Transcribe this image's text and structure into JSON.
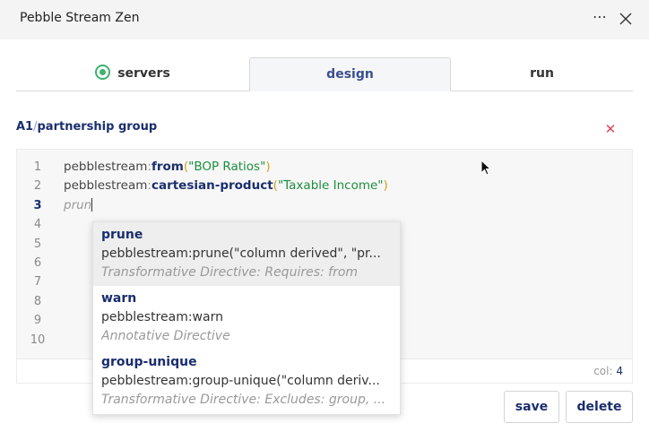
{
  "window": {
    "title": "Pebble Stream Zen",
    "more_icon": "⋯",
    "close_icon": "close-icon"
  },
  "tabs": [
    {
      "label": "servers",
      "status": "connected",
      "status_color": "#3cb371"
    },
    {
      "label": "design",
      "active": true
    },
    {
      "label": "run"
    }
  ],
  "breadcrumb": {
    "prefix": "A1",
    "separator": "/",
    "name": "partnership group",
    "remove_icon": "✕"
  },
  "editor": {
    "line_numbers": [
      "1",
      "2",
      "3",
      "4",
      "5",
      "6",
      "7",
      "8",
      "9",
      "10"
    ],
    "active_line": "3",
    "lines": [
      {
        "ns": "pebblestream",
        "colon": ":",
        "fn": "from",
        "open": "(",
        "arg": "\"BOP Ratios\"",
        "close": ")"
      },
      {
        "ns": "pebblestream",
        "colon": ":",
        "fn": "cartesian-product",
        "open": "(",
        "arg": "\"Taxable Income\"",
        "close": ")"
      },
      {
        "typing": "prun"
      }
    ],
    "status": {
      "col_label": "col:",
      "col_value": "4"
    }
  },
  "autocomplete": [
    {
      "name": "prune",
      "signature": "pebblestream:prune(\"column derived\", \"pr...",
      "description": "Transformative Directive: Requires: from",
      "selected": true
    },
    {
      "name": "warn",
      "signature": "pebblestream:warn",
      "description": "Annotative Directive"
    },
    {
      "name": "group-unique",
      "signature": "pebblestream:group-unique(\"column deriv...",
      "description": "Transformative Directive: Excludes: group, ..."
    }
  ],
  "actions": {
    "save_label": "save",
    "delete_label": "delete"
  },
  "colors": {
    "accent": "#1a2e6e",
    "string": "#1e8e3e",
    "paren": "#d4a017",
    "danger": "#e0455a"
  }
}
